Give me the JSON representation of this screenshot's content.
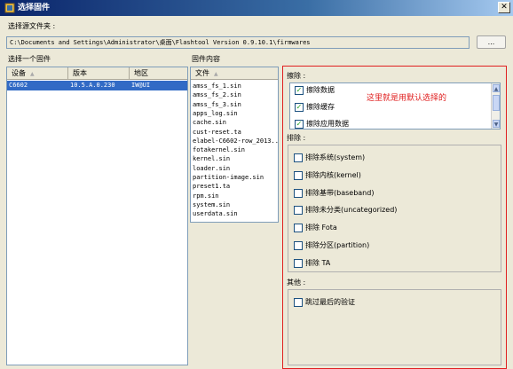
{
  "window": {
    "title": "选择固件",
    "close_glyph": "✕"
  },
  "folder": {
    "label": "选择源文件夹 :",
    "path": "C:\\Documents and Settings\\Administrator\\桌面\\Flashtool Version 0.9.10.1\\firmwares",
    "browse_label": "..."
  },
  "firmware": {
    "label": "选择一个固件",
    "columns": [
      "设备",
      "版本",
      "地区"
    ],
    "sort_glyph": "▲",
    "row": {
      "device": "C6602",
      "version": "10.5.A.0.230",
      "region": "IW@UI"
    }
  },
  "content": {
    "label": "固件内容",
    "column": "文件",
    "sort_glyph": "▲",
    "files": [
      "amss_fs_1.sin",
      "amss_fs_2.sin",
      "amss_fs_3.sin",
      "apps_log.sin",
      "cache.sin",
      "cust-reset.ta",
      "elabel-C6602-row_2013...",
      "fotakernel.sin",
      "kernel.sin",
      "loader.sin",
      "partition-image.sin",
      "preset1.ta",
      "rpm.sin",
      "system.sin",
      "userdata.sin"
    ]
  },
  "wipe": {
    "label": "擦除 :",
    "items": [
      {
        "label": "擦除数据",
        "checked": true
      },
      {
        "label": "擦除缓存",
        "checked": true
      },
      {
        "label": "擦除应用数据",
        "checked": true
      }
    ],
    "annotation": "这里就是用默认选择的"
  },
  "exclude": {
    "label": "排除 :",
    "items": [
      {
        "label": "排除系统(system)",
        "checked": false
      },
      {
        "label": "排除内核(kernel)",
        "checked": false
      },
      {
        "label": "排除基带(baseband)",
        "checked": false
      },
      {
        "label": "排除未分类(uncategorized)",
        "checked": false
      },
      {
        "label": "排除 Fota",
        "checked": false
      },
      {
        "label": "排除分区(partition)",
        "checked": false
      },
      {
        "label": "排除 TA",
        "checked": false
      }
    ]
  },
  "misc": {
    "label": "其他 :",
    "items": [
      {
        "label": "跳过最后的验证",
        "checked": false
      }
    ]
  },
  "check_glyph": "✓",
  "scroll": {
    "up_glyph": "▲",
    "down_glyph": "▼"
  },
  "colors": {
    "title_start": "#0a246a",
    "selection": "#316ac5",
    "annotation": "#e02020",
    "check": "#21a121"
  }
}
